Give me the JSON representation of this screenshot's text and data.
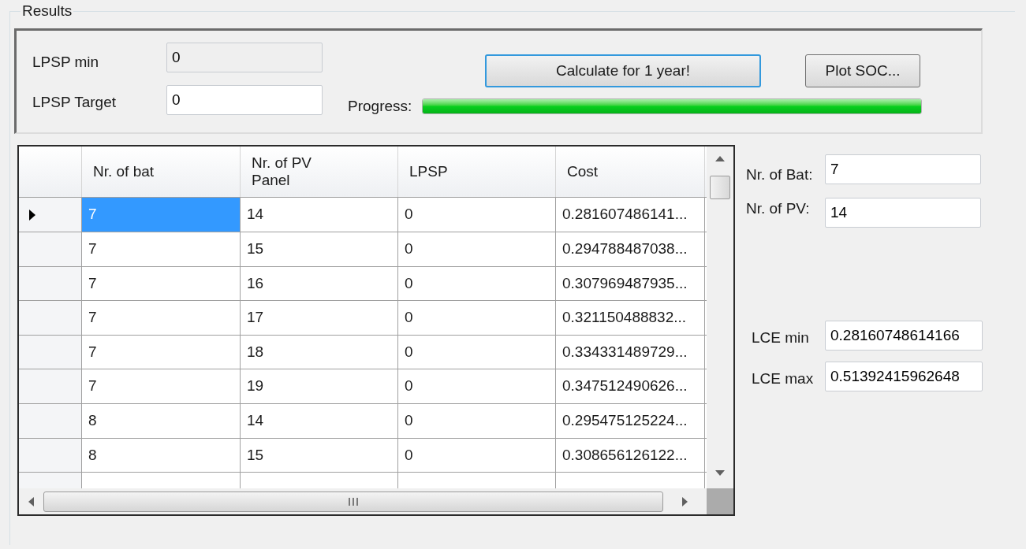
{
  "group_title": "Results",
  "lpsp_min": {
    "label": "LPSP min",
    "value": "0",
    "disabled": true
  },
  "lpsp_target": {
    "label": "LPSP Target",
    "value": "0",
    "disabled": false
  },
  "calculate_button": {
    "label": "Calculate for 1 year!",
    "focused": true
  },
  "plot_button": {
    "label": "Plot SOC..."
  },
  "progress": {
    "label": "Progress:",
    "level": 1.0
  },
  "table": {
    "columns": [
      "Nr. of bat",
      "Nr. of PV\nPanel",
      "LPSP",
      "Cost"
    ],
    "rows": [
      {
        "cells": [
          "7",
          "14",
          "0",
          "0.281607486141..."
        ],
        "selected": true
      },
      {
        "cells": [
          "7",
          "15",
          "0",
          "0.294788487038..."
        ],
        "selected": false
      },
      {
        "cells": [
          "7",
          "16",
          "0",
          "0.307969487935..."
        ],
        "selected": false
      },
      {
        "cells": [
          "7",
          "17",
          "0",
          "0.321150488832..."
        ],
        "selected": false
      },
      {
        "cells": [
          "7",
          "18",
          "0",
          "0.334331489729..."
        ],
        "selected": false
      },
      {
        "cells": [
          "7",
          "19",
          "0",
          "0.347512490626..."
        ],
        "selected": false
      },
      {
        "cells": [
          "8",
          "14",
          "0",
          "0.295475125224..."
        ],
        "selected": false
      },
      {
        "cells": [
          "8",
          "15",
          "0",
          "0.308656126122..."
        ],
        "selected": false
      }
    ]
  },
  "nr_of_bat": {
    "label": "Nr. of Bat:",
    "value": "7"
  },
  "nr_of_pv": {
    "label": "Nr. of PV:",
    "value": "14"
  },
  "lce_min": {
    "label": "LCE min",
    "value": "0.28160748614166"
  },
  "lce_max": {
    "label": "LCE max",
    "value": "0.51392415962648"
  }
}
